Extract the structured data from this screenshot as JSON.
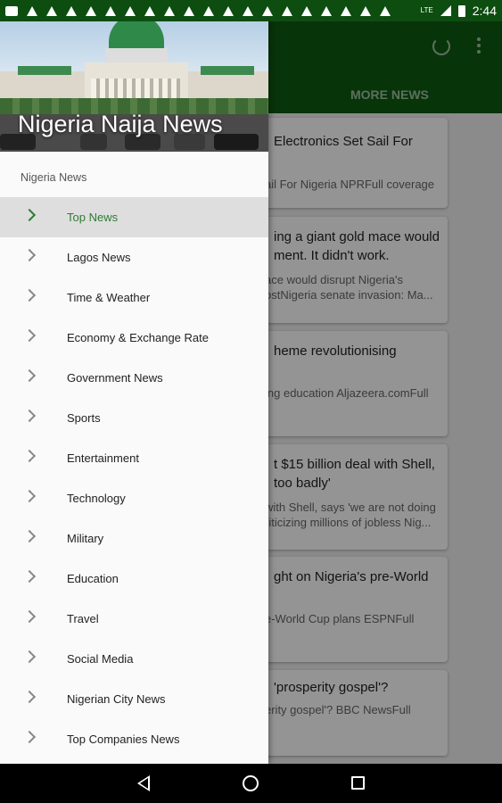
{
  "status_bar": {
    "time": "2:44",
    "network": "LTE"
  },
  "app": {
    "tab_label": "MORE NEWS",
    "cards": [
      {
        "title": "Electronics Set Sail For",
        "desc": "ail For Nigeria  NPRFull coverage"
      },
      {
        "title": "ing a giant gold mace would ment. It didn't work.",
        "desc": "ace would disrupt Nigeria's ostNigeria senate invasion: Ma..."
      },
      {
        "title": "heme revolutionising",
        "desc": "ing education  Aljazeera.comFull"
      },
      {
        "title": "t $15 billion deal with Shell, too badly'",
        "desc": "with Shell, says 'we are not doing riticizing millions of jobless Nig..."
      },
      {
        "title": "ght on Nigeria's pre-World",
        "desc": "e-World Cup plans  ESPNFull"
      },
      {
        "title": "'prosperity gospel'?",
        "desc": "erity gospel'?  BBC NewsFull"
      }
    ]
  },
  "drawer": {
    "title": "Nigeria Naija News",
    "section_label": "Nigeria News",
    "items": [
      {
        "label": "Top News",
        "active": true
      },
      {
        "label": "Lagos News"
      },
      {
        "label": "Time & Weather"
      },
      {
        "label": "Economy & Exchange Rate"
      },
      {
        "label": "Government News"
      },
      {
        "label": "Sports"
      },
      {
        "label": "Entertainment"
      },
      {
        "label": "Technology"
      },
      {
        "label": "Military"
      },
      {
        "label": "Education"
      },
      {
        "label": "Travel"
      },
      {
        "label": "Social Media"
      },
      {
        "label": "Nigerian City News"
      },
      {
        "label": "Top Companies News"
      }
    ]
  },
  "nav_bar": {
    "back": "back-icon",
    "home": "home-icon",
    "recents": "recents-icon"
  },
  "colors": {
    "toolbar": "#0e5a12",
    "accent": "#2e7d32",
    "status_bar": "#0d4d10"
  }
}
